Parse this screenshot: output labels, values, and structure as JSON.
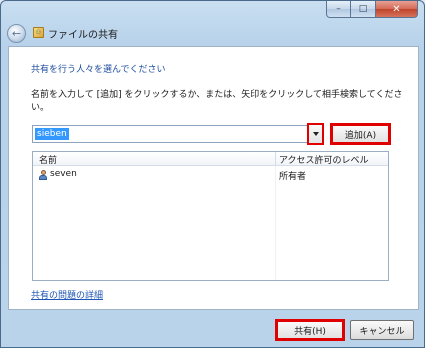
{
  "window": {
    "title": "ファイルの共有",
    "caption_buttons": {
      "minimize": "–",
      "maximize": "□",
      "close": "✕"
    }
  },
  "dialog": {
    "heading": "共有を行う人々を選んでください",
    "instructions": "名前を入力して [追加] をクリックするか、または、矢印をクリックして相手検索してください。",
    "name_input": {
      "value": "sieben"
    },
    "add_button": "追加(A)",
    "list": {
      "columns": [
        "名前",
        "アクセス許可のレベル"
      ],
      "rows": [
        {
          "name": "seven",
          "permission": "所有者",
          "icon": "user-icon"
        }
      ]
    },
    "help_link": "共有の問題の詳細",
    "share_button": "共有(H)",
    "cancel_button": "キャンセル"
  },
  "colors": {
    "highlight_box": "#e00000",
    "heading_blue": "#1f4fa0",
    "link_blue": "#1f55b5",
    "selection": "#3399ff"
  }
}
